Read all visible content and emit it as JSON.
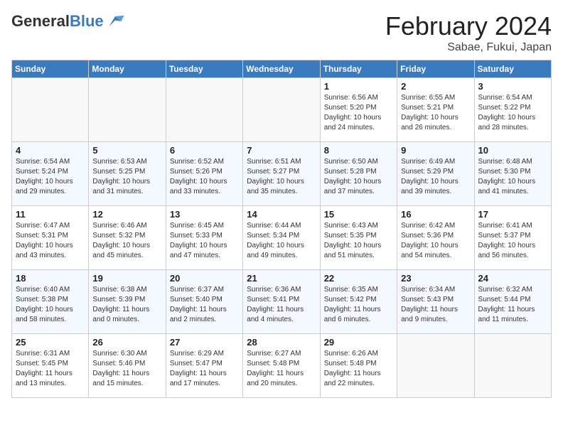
{
  "app": {
    "name_general": "General",
    "name_blue": "Blue"
  },
  "header": {
    "month": "February 2024",
    "location": "Sabae, Fukui, Japan"
  },
  "weekdays": [
    "Sunday",
    "Monday",
    "Tuesday",
    "Wednesday",
    "Thursday",
    "Friday",
    "Saturday"
  ],
  "weeks": [
    [
      {
        "day": "",
        "info": ""
      },
      {
        "day": "",
        "info": ""
      },
      {
        "day": "",
        "info": ""
      },
      {
        "day": "",
        "info": ""
      },
      {
        "day": "1",
        "info": "Sunrise: 6:56 AM\nSunset: 5:20 PM\nDaylight: 10 hours\nand 24 minutes."
      },
      {
        "day": "2",
        "info": "Sunrise: 6:55 AM\nSunset: 5:21 PM\nDaylight: 10 hours\nand 26 minutes."
      },
      {
        "day": "3",
        "info": "Sunrise: 6:54 AM\nSunset: 5:22 PM\nDaylight: 10 hours\nand 28 minutes."
      }
    ],
    [
      {
        "day": "4",
        "info": "Sunrise: 6:54 AM\nSunset: 5:24 PM\nDaylight: 10 hours\nand 29 minutes."
      },
      {
        "day": "5",
        "info": "Sunrise: 6:53 AM\nSunset: 5:25 PM\nDaylight: 10 hours\nand 31 minutes."
      },
      {
        "day": "6",
        "info": "Sunrise: 6:52 AM\nSunset: 5:26 PM\nDaylight: 10 hours\nand 33 minutes."
      },
      {
        "day": "7",
        "info": "Sunrise: 6:51 AM\nSunset: 5:27 PM\nDaylight: 10 hours\nand 35 minutes."
      },
      {
        "day": "8",
        "info": "Sunrise: 6:50 AM\nSunset: 5:28 PM\nDaylight: 10 hours\nand 37 minutes."
      },
      {
        "day": "9",
        "info": "Sunrise: 6:49 AM\nSunset: 5:29 PM\nDaylight: 10 hours\nand 39 minutes."
      },
      {
        "day": "10",
        "info": "Sunrise: 6:48 AM\nSunset: 5:30 PM\nDaylight: 10 hours\nand 41 minutes."
      }
    ],
    [
      {
        "day": "11",
        "info": "Sunrise: 6:47 AM\nSunset: 5:31 PM\nDaylight: 10 hours\nand 43 minutes."
      },
      {
        "day": "12",
        "info": "Sunrise: 6:46 AM\nSunset: 5:32 PM\nDaylight: 10 hours\nand 45 minutes."
      },
      {
        "day": "13",
        "info": "Sunrise: 6:45 AM\nSunset: 5:33 PM\nDaylight: 10 hours\nand 47 minutes."
      },
      {
        "day": "14",
        "info": "Sunrise: 6:44 AM\nSunset: 5:34 PM\nDaylight: 10 hours\nand 49 minutes."
      },
      {
        "day": "15",
        "info": "Sunrise: 6:43 AM\nSunset: 5:35 PM\nDaylight: 10 hours\nand 51 minutes."
      },
      {
        "day": "16",
        "info": "Sunrise: 6:42 AM\nSunset: 5:36 PM\nDaylight: 10 hours\nand 54 minutes."
      },
      {
        "day": "17",
        "info": "Sunrise: 6:41 AM\nSunset: 5:37 PM\nDaylight: 10 hours\nand 56 minutes."
      }
    ],
    [
      {
        "day": "18",
        "info": "Sunrise: 6:40 AM\nSunset: 5:38 PM\nDaylight: 10 hours\nand 58 minutes."
      },
      {
        "day": "19",
        "info": "Sunrise: 6:38 AM\nSunset: 5:39 PM\nDaylight: 11 hours\nand 0 minutes."
      },
      {
        "day": "20",
        "info": "Sunrise: 6:37 AM\nSunset: 5:40 PM\nDaylight: 11 hours\nand 2 minutes."
      },
      {
        "day": "21",
        "info": "Sunrise: 6:36 AM\nSunset: 5:41 PM\nDaylight: 11 hours\nand 4 minutes."
      },
      {
        "day": "22",
        "info": "Sunrise: 6:35 AM\nSunset: 5:42 PM\nDaylight: 11 hours\nand 6 minutes."
      },
      {
        "day": "23",
        "info": "Sunrise: 6:34 AM\nSunset: 5:43 PM\nDaylight: 11 hours\nand 9 minutes."
      },
      {
        "day": "24",
        "info": "Sunrise: 6:32 AM\nSunset: 5:44 PM\nDaylight: 11 hours\nand 11 minutes."
      }
    ],
    [
      {
        "day": "25",
        "info": "Sunrise: 6:31 AM\nSunset: 5:45 PM\nDaylight: 11 hours\nand 13 minutes."
      },
      {
        "day": "26",
        "info": "Sunrise: 6:30 AM\nSunset: 5:46 PM\nDaylight: 11 hours\nand 15 minutes."
      },
      {
        "day": "27",
        "info": "Sunrise: 6:29 AM\nSunset: 5:47 PM\nDaylight: 11 hours\nand 17 minutes."
      },
      {
        "day": "28",
        "info": "Sunrise: 6:27 AM\nSunset: 5:48 PM\nDaylight: 11 hours\nand 20 minutes."
      },
      {
        "day": "29",
        "info": "Sunrise: 6:26 AM\nSunset: 5:48 PM\nDaylight: 11 hours\nand 22 minutes."
      },
      {
        "day": "",
        "info": ""
      },
      {
        "day": "",
        "info": ""
      }
    ]
  ]
}
